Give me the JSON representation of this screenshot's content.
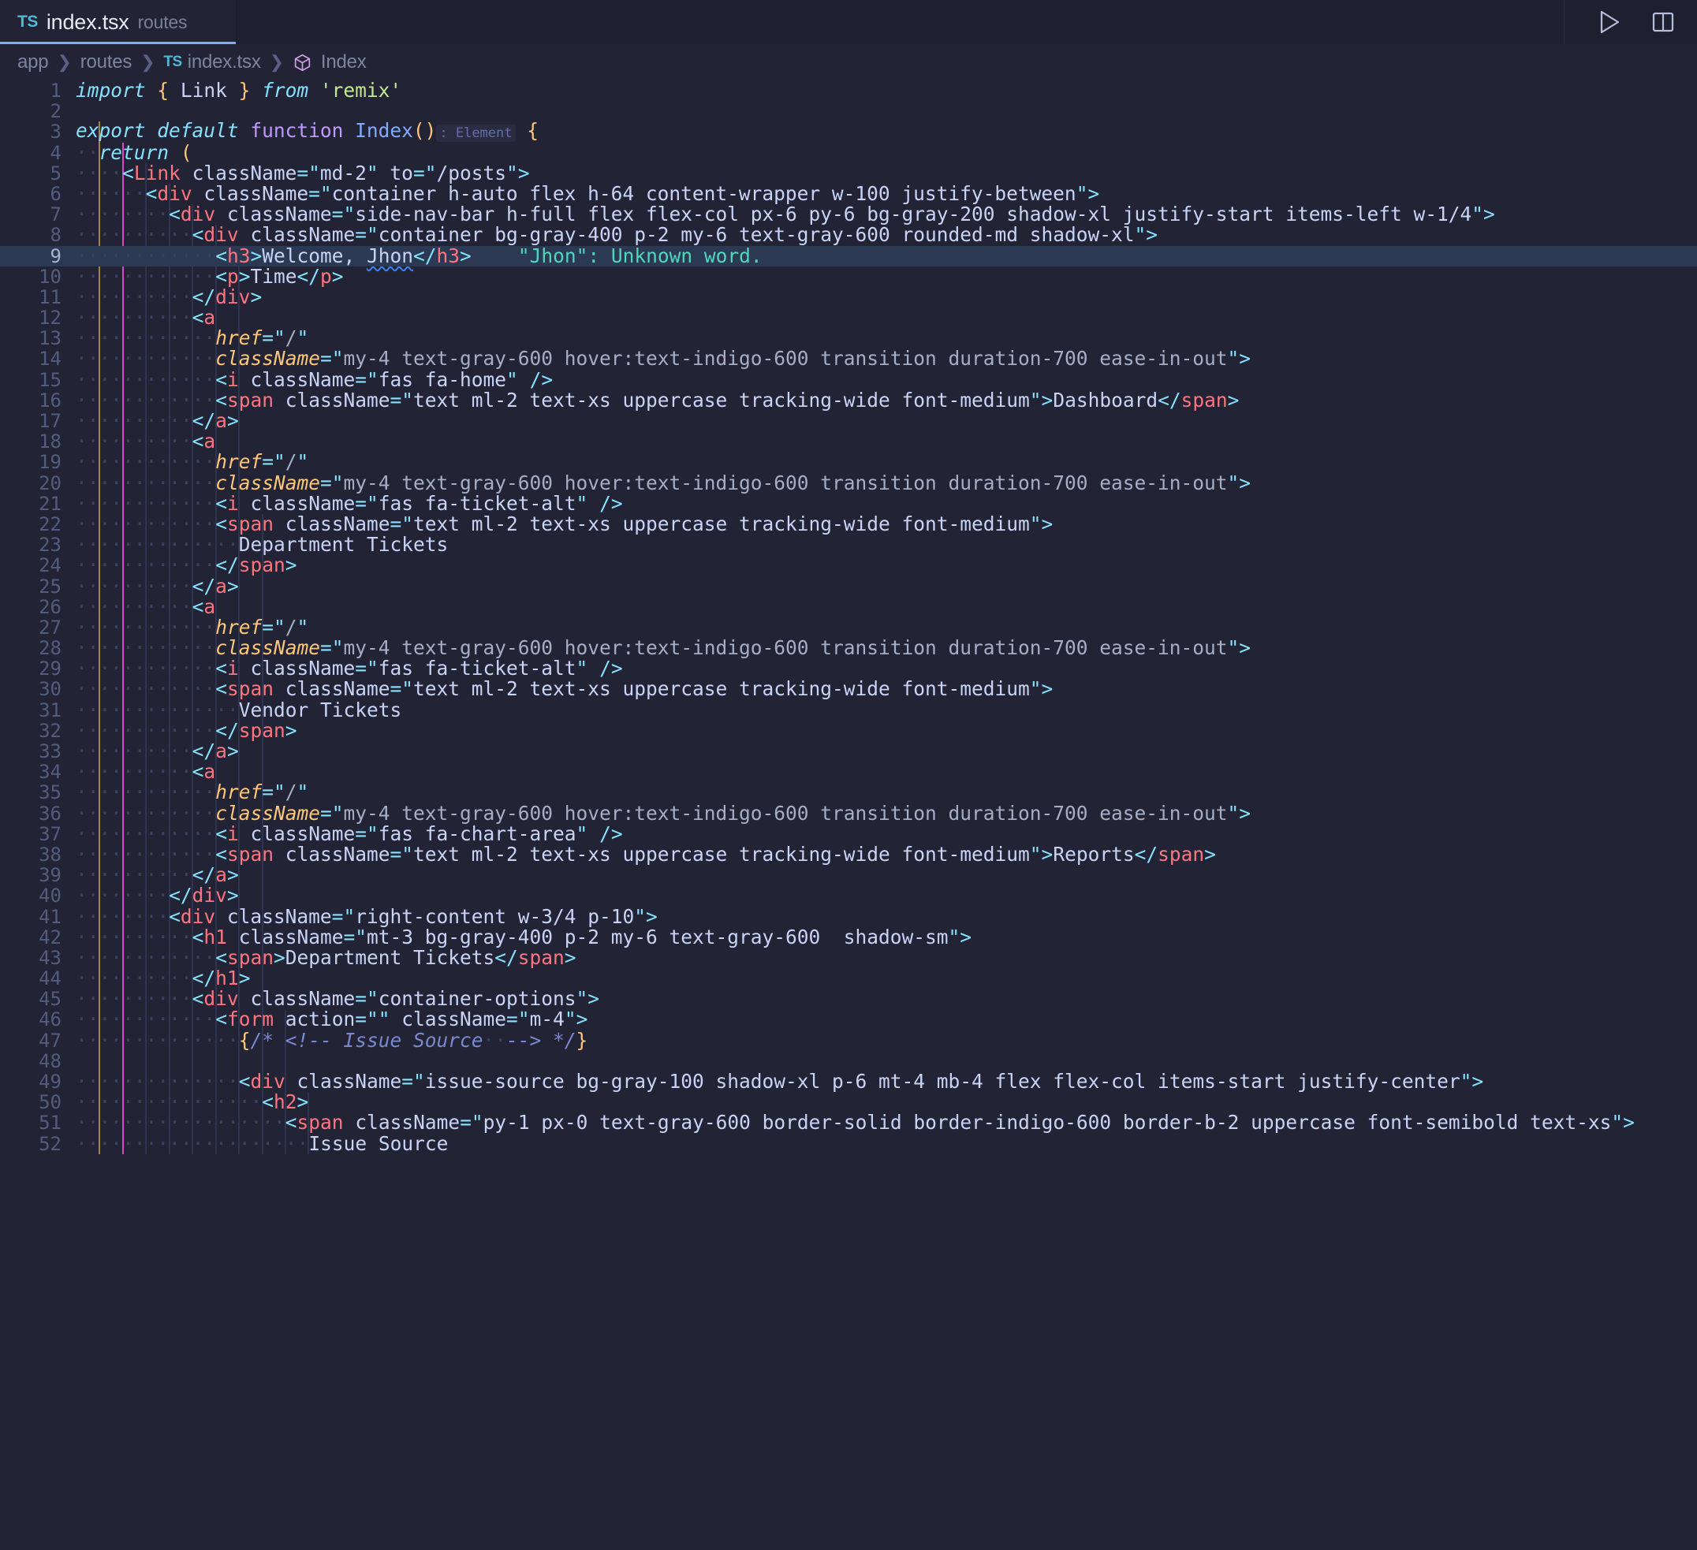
{
  "tab": {
    "badge": "TS",
    "filename": "index.tsx",
    "folder": "routes"
  },
  "titlebar_actions": [
    {
      "name": "run-icon",
      "label": "Run"
    },
    {
      "name": "split-editor-icon",
      "label": "Split Editor Right"
    }
  ],
  "breadcrumb": {
    "app": "app",
    "routes": "routes",
    "ts_badge": "TS",
    "file": "index.tsx",
    "symbol": "Index",
    "separator": "❯"
  },
  "editor": {
    "active_line": 9,
    "lines": [
      {
        "n": 1,
        "text": "import { Link } from 'remix'"
      },
      {
        "n": 2,
        "text": ""
      },
      {
        "n": 3,
        "text": "export default function Index(): Element {"
      },
      {
        "n": 4,
        "text": "  return ("
      },
      {
        "n": 5,
        "text": "    <Link className=\"md-2\" to=\"/posts\">"
      },
      {
        "n": 6,
        "text": "      <div className=\"container h-auto flex h-64 content-wrapper w-100 justify-between\">"
      },
      {
        "n": 7,
        "text": "        <div className=\"side-nav-bar h-full flex flex-col px-6 py-6 bg-gray-200 shadow-xl justify-start items-left w-1/4\">"
      },
      {
        "n": 8,
        "text": "          <div className=\"container bg-gray-400 p-2 my-6 text-gray-600 rounded-md shadow-xl\">"
      },
      {
        "n": 9,
        "text": "            <h3>Welcome, Jhon</h3>    \"Jhon\": Unknown word."
      },
      {
        "n": 10,
        "text": "            <p>Time</p>"
      },
      {
        "n": 11,
        "text": "          </div>"
      },
      {
        "n": 12,
        "text": "          <a"
      },
      {
        "n": 13,
        "text": "            href=\"/\""
      },
      {
        "n": 14,
        "text": "            className=\"my-4 text-gray-600 hover:text-indigo-600 transition duration-700 ease-in-out\">"
      },
      {
        "n": 15,
        "text": "            <i className=\"fas fa-home\" />"
      },
      {
        "n": 16,
        "text": "            <span className=\"text ml-2 text-xs uppercase tracking-wide font-medium\">Dashboard</span>"
      },
      {
        "n": 17,
        "text": "          </a>"
      },
      {
        "n": 18,
        "text": "          <a"
      },
      {
        "n": 19,
        "text": "            href=\"/\""
      },
      {
        "n": 20,
        "text": "            className=\"my-4 text-gray-600 hover:text-indigo-600 transition duration-700 ease-in-out\">"
      },
      {
        "n": 21,
        "text": "            <i className=\"fas fa-ticket-alt\" />"
      },
      {
        "n": 22,
        "text": "            <span className=\"text ml-2 text-xs uppercase tracking-wide font-medium\">"
      },
      {
        "n": 23,
        "text": "              Department Tickets"
      },
      {
        "n": 24,
        "text": "            </span>"
      },
      {
        "n": 25,
        "text": "          </a>"
      },
      {
        "n": 26,
        "text": "          <a"
      },
      {
        "n": 27,
        "text": "            href=\"/\""
      },
      {
        "n": 28,
        "text": "            className=\"my-4 text-gray-600 hover:text-indigo-600 transition duration-700 ease-in-out\">"
      },
      {
        "n": 29,
        "text": "            <i className=\"fas fa-ticket-alt\" />"
      },
      {
        "n": 30,
        "text": "            <span className=\"text ml-2 text-xs uppercase tracking-wide font-medium\">"
      },
      {
        "n": 31,
        "text": "              Vendor Tickets"
      },
      {
        "n": 32,
        "text": "            </span>"
      },
      {
        "n": 33,
        "text": "          </a>"
      },
      {
        "n": 34,
        "text": "          <a"
      },
      {
        "n": 35,
        "text": "            href=\"/\""
      },
      {
        "n": 36,
        "text": "            className=\"my-4 text-gray-600 hover:text-indigo-600 transition duration-700 ease-in-out\">"
      },
      {
        "n": 37,
        "text": "            <i className=\"fas fa-chart-area\" />"
      },
      {
        "n": 38,
        "text": "            <span className=\"text ml-2 text-xs uppercase tracking-wide font-medium\">Reports</span>"
      },
      {
        "n": 39,
        "text": "          </a>"
      },
      {
        "n": 40,
        "text": "        </div>"
      },
      {
        "n": 41,
        "text": "        <div className=\"right-content w-3/4 p-10\">"
      },
      {
        "n": 42,
        "text": "          <h1 className=\"mt-3 bg-gray-400 p-2 my-6 text-gray-600  shadow-sm\">"
      },
      {
        "n": 43,
        "text": "            <span>Department Tickets</span>"
      },
      {
        "n": 44,
        "text": "          </h1>"
      },
      {
        "n": 45,
        "text": "          <div className=\"container-options\">"
      },
      {
        "n": 46,
        "text": "            <form action=\"\" className=\"m-4\">"
      },
      {
        "n": 47,
        "text": "              {/* <!-- Issue Source  --> */}"
      },
      {
        "n": 48,
        "text": ""
      },
      {
        "n": 49,
        "text": "              <div className=\"issue-source bg-gray-100 shadow-xl p-6 mt-4 mb-4 flex flex-col items-start justify-center\">"
      },
      {
        "n": 50,
        "text": "                <h2>"
      },
      {
        "n": 51,
        "text": "                  <span className=\"py-1 px-0 text-gray-600 border-solid border-indigo-600 border-b-2 uppercase font-semibold text-xs\">"
      },
      {
        "n": 52,
        "text": "                    Issue Source"
      }
    ],
    "inlay_hint": ": Element",
    "diagnostic": {
      "word": "Jhon",
      "message": "\"Jhon\": Unknown word."
    }
  },
  "colors": {
    "background": "#222436",
    "tabbar_background": "#1e2030",
    "active_tab_accent": "#82aaff",
    "active_line": "#2b3a52",
    "line_number": "#545c7e",
    "keyword": "#86e1fc",
    "function": "#c099ff",
    "string": "#c3e88d",
    "tag": "#ff757f",
    "attribute": "#ffc777",
    "attribute_value": "#a5aec6",
    "comment": "#7a88cf",
    "hint": "#4fd6be",
    "spell_underline": "#3d81f0"
  }
}
